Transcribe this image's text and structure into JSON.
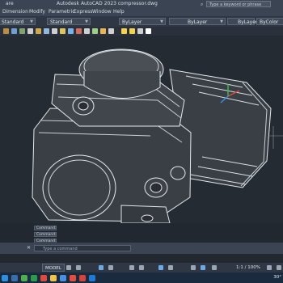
{
  "titlebar": {
    "app_fragment": "are",
    "title": "Autodesk AutoCAD 2023    compressor.dwg",
    "search_placeholder": "Type a keyword or phrase"
  },
  "menubar": {
    "items": [
      "Dimension",
      "Modify",
      "Parametric",
      "Express",
      "Window",
      "Help"
    ]
  },
  "properties": {
    "style1": "Standard",
    "style2": "Standard",
    "layer": "ByLayer",
    "color": "ByLayer",
    "linetype": "ByLayer",
    "lineweight": "ByColor"
  },
  "command_history": [
    "Command:",
    "Command:",
    "Command:"
  ],
  "command_line": {
    "placeholder": "Type a command"
  },
  "status": {
    "model_label": "MODEL",
    "scale": "1:1 / 100%"
  },
  "taskbar": {
    "temp": "30°"
  },
  "colors": {
    "background": "#252b33",
    "ucs_x": "#e24a3b",
    "ucs_y": "#3ec14a",
    "ucs_z": "#3a8ff0"
  }
}
